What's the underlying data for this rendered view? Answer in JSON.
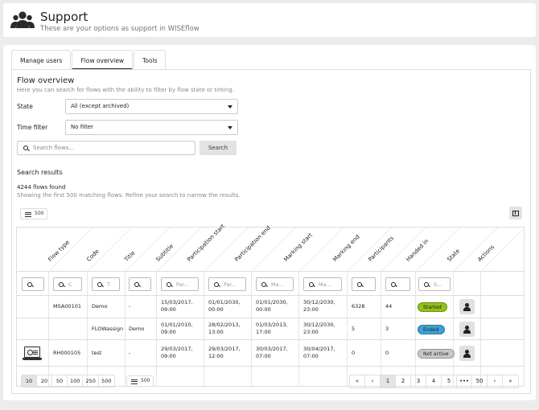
{
  "header": {
    "title": "Support",
    "subtitle": "These are your options as support in WISEflow"
  },
  "tabs": [
    {
      "label": "Manage users",
      "active": false
    },
    {
      "label": "Flow overview",
      "active": true
    },
    {
      "label": "Tools",
      "active": false
    }
  ],
  "overview": {
    "title": "Flow overview",
    "description": "Here you can search for flows with the ability to filter by flow state or timing.",
    "state_label": "State",
    "state_value": "All (except archived)",
    "time_filter_label": "Time filter",
    "time_filter_value": "No filter",
    "search_placeholder": "Search flows...",
    "search_button": "Search"
  },
  "results": {
    "title": "Search results",
    "count": "4244 flows found",
    "note": "Showing the first 500 matching flows. Refine your search to narrow the results.",
    "rows_per_page": "500"
  },
  "table": {
    "columns": [
      "Flow type",
      "Code",
      "Title",
      "Subtitle",
      "Participation start",
      "Participation end",
      "Marking start",
      "Marking end",
      "Participants",
      "Handed in",
      "State",
      "Actions"
    ],
    "filter_placeholders": [
      "",
      "C",
      "T",
      "",
      "Par...",
      "Par...",
      "Ma...",
      "Ma...",
      "",
      "",
      "S...",
      ""
    ],
    "rows": [
      {
        "flow_type_icon": "",
        "code": "MSA00101",
        "title": "Demo",
        "subtitle": "-",
        "participation_start": "15/03/2017, 09:00",
        "participation_end": "01/01/2030, 00:00",
        "marking_start": "01/01/2030, 00:00",
        "marking_end": "30/12/2030, 23:00",
        "participants": "6328",
        "handed_in": "44",
        "state": "Started",
        "state_color": "#8fc21b"
      },
      {
        "flow_type_icon": "",
        "code": "FLOWassign",
        "title": "Demo",
        "subtitle": "",
        "participation_start": "01/01/2010, 09:00",
        "participation_end": "28/02/2013, 13:00",
        "marking_start": "01/03/2013, 17:00",
        "marking_end": "30/12/2030, 23:00",
        "participants": "5",
        "handed_in": "3",
        "state": "Ended",
        "state_color": "#3ea0d6"
      },
      {
        "flow_type_icon": "laptop-icon",
        "code": "RH000105",
        "title": "test",
        "subtitle": "-",
        "participation_start": "29/03/2017, 09:00",
        "participation_end": "29/03/2017, 12:00",
        "marking_start": "30/03/2017, 07:00",
        "marking_end": "30/04/2017, 07:00",
        "participants": "0",
        "handed_in": "0",
        "state": "Not active",
        "state_color": "#c8c8c8"
      }
    ]
  },
  "page_sizes": [
    "10",
    "20",
    "50",
    "100",
    "250",
    "500"
  ],
  "page_size_active": "10",
  "bottom_rows_label": "500",
  "pagination": [
    "«",
    "‹",
    "1",
    "2",
    "3",
    "4",
    "5",
    "•••",
    "50",
    "›",
    "»"
  ],
  "pagination_active": "1"
}
